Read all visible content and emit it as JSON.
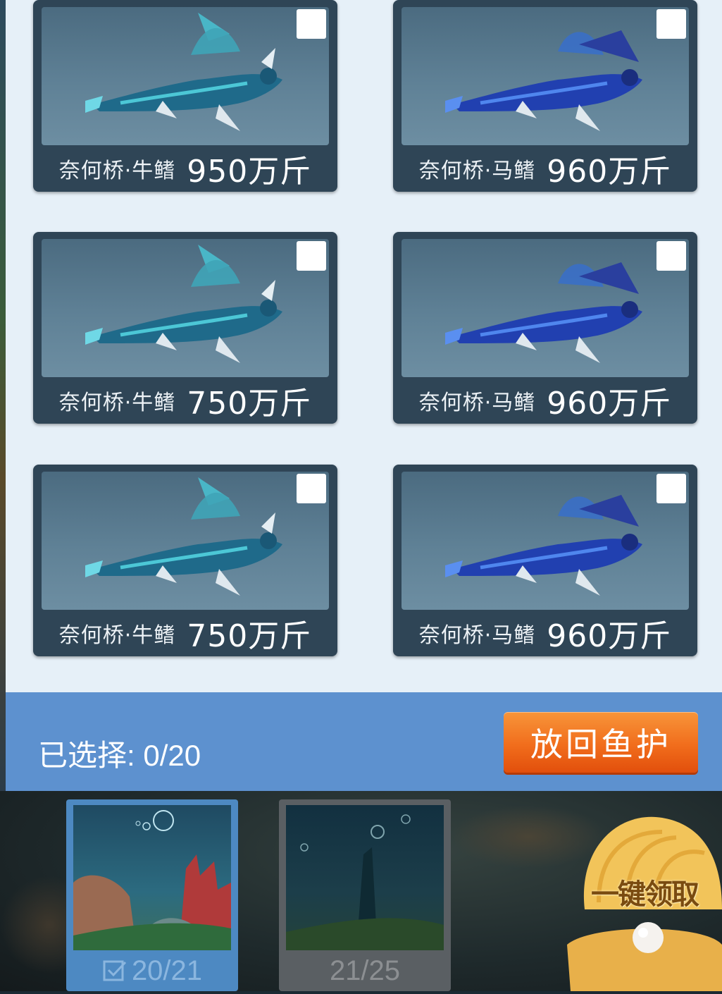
{
  "fish_cards": [
    {
      "name": "奈何桥·牛鳍",
      "weight": "950万斤",
      "variant": "bull",
      "checked": false
    },
    {
      "name": "奈何桥·马鳍",
      "weight": "960万斤",
      "variant": "horse",
      "checked": false
    },
    {
      "name": "奈何桥·牛鳍",
      "weight": "750万斤",
      "variant": "bull",
      "checked": false
    },
    {
      "name": "奈何桥·马鳍",
      "weight": "960万斤",
      "variant": "horse",
      "checked": false
    },
    {
      "name": "奈何桥·牛鳍",
      "weight": "750万斤",
      "variant": "bull",
      "checked": false
    },
    {
      "name": "奈何桥·马鳍",
      "weight": "960万斤",
      "variant": "horse",
      "checked": false
    }
  ],
  "footer": {
    "selected_text": "已选择: 0/20",
    "return_button": "放回鱼护"
  },
  "tanks": [
    {
      "count": "20/21",
      "active": true,
      "icon": "checkbox-checked-icon"
    },
    {
      "count": "21/25",
      "active": false
    }
  ],
  "collect_button": "一键领取",
  "colors": {
    "panel_bg": "#e6f0f8",
    "card_bg": "#2f4556",
    "footer_bg": "#5d91cf",
    "button_orange": "#f16d1c",
    "tank_active": "#4d89c2",
    "tank_inactive": "#5a5f63"
  }
}
